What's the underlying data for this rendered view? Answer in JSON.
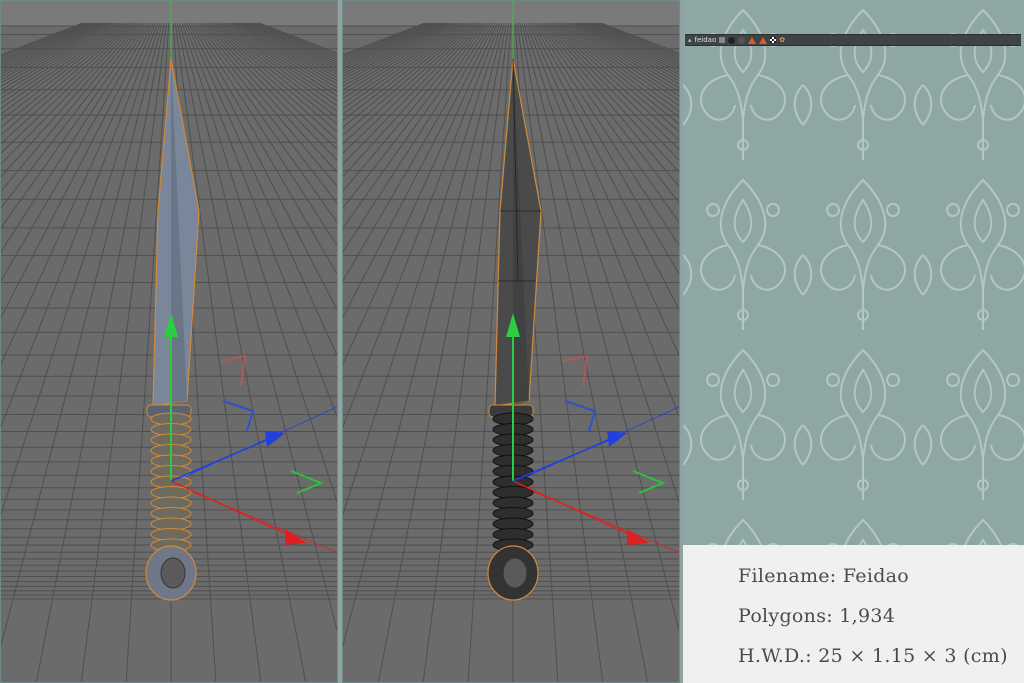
{
  "viewports": [
    {
      "id": "viewport-shaded",
      "mode": "shaded"
    },
    {
      "id": "viewport-wireframe",
      "mode": "shaded-wireframe"
    }
  ],
  "toolbar": {
    "object_name": "feidao",
    "icons": [
      "object-icon",
      "material-icon",
      "sphere-icon",
      "sphere-icon",
      "cone-icon",
      "cone-icon",
      "checker-icon",
      "texture-icon"
    ]
  },
  "info": {
    "filename": "Filename: Feidao",
    "polygons": "Polygons: 1,934",
    "dimensions": "H.W.D.: 25 × 1.15 × 3 (cm)"
  },
  "colors": {
    "viewport_bg": "#6b6b6b",
    "grid_line": "#4f4f4f",
    "blade": "#7a8699",
    "selection_outline": "#d08a3a",
    "axis_y": "#2ecc40",
    "axis_x": "#e02020",
    "axis_z": "#2040e0",
    "panel_bg": "#8ea6a4",
    "info_bg": "#eef1ee"
  }
}
